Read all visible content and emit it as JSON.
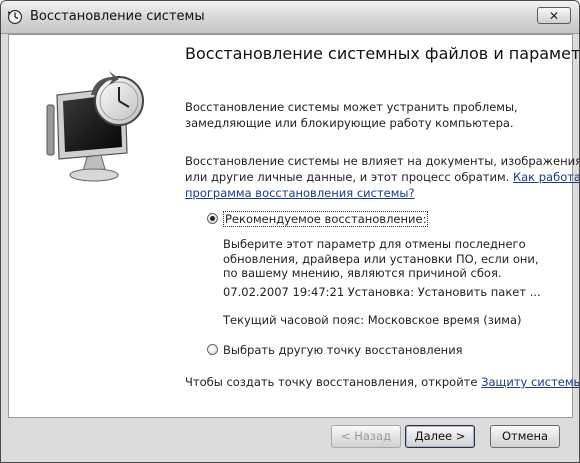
{
  "window": {
    "title": "Восстановление системы",
    "close_label": "✕"
  },
  "main": {
    "heading": "Восстановление системных файлов и параметров",
    "para1_line1": "Восстановление системы может устранить проблемы,",
    "para1_line2": "замедляющие или блокирующие работу компьютера.",
    "para2_line1": "Восстановление системы не влияет на документы, изображения",
    "para2_line2_text": "или другие личные данные, и этот процесс обратим. ",
    "para2_link_part1": "Как работает",
    "para2_link_part2": "программа восстановления системы?"
  },
  "options": {
    "recommended": {
      "label": "Рекомендуемое восстановление:",
      "selected": true,
      "desc_line1": "Выберите этот параметр для отмены последнего",
      "desc_line2": "обновления, драйвера или установки ПО, если они,",
      "desc_line3": "по вашему мнению, являются причиной сбоя.",
      "restore_point": "07.02.2007 19:47:21 Установка: Установить пакет ...",
      "timezone": "Текущий часовой пояс: Московское время (зима)"
    },
    "other": {
      "label": "Выбрать другую точку восстановления",
      "selected": false
    }
  },
  "footer": {
    "text": "Чтобы создать точку восстановления, откройте ",
    "link": "Защиту системы",
    "text_end": "."
  },
  "buttons": {
    "back": "< Назад",
    "next": "Далее >",
    "cancel": "Отмена"
  },
  "icons": {
    "title": "system-restore-icon",
    "hero": "monitor-clock-icon"
  }
}
